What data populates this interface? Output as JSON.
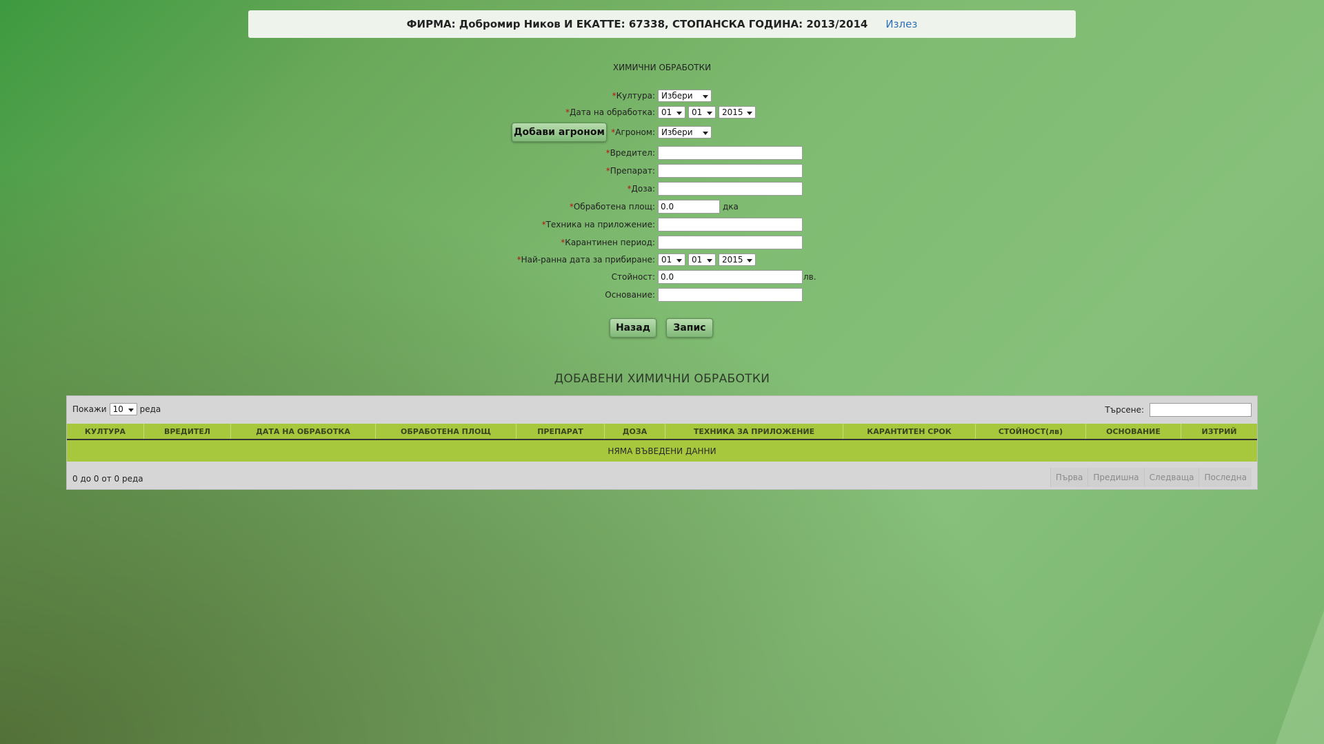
{
  "header": {
    "company_line": "ФИРМА: Добромир Ников И ЕКАТТЕ: 67338, СТОПАНСКА ГОДИНА: 2013/2014",
    "logout_label": "Излез"
  },
  "form": {
    "title": "ХИМИЧНИ ОБРАБОТКИ",
    "required_mark": "*",
    "culture": {
      "label": "Култура:",
      "value": "Избери"
    },
    "treatment_date": {
      "label": "Дата на обработка:",
      "day": "01",
      "month": "01",
      "year": "2015"
    },
    "add_agronomist_button": "Добави агроном",
    "agronomist": {
      "label": "Агроном:",
      "value": "Избери"
    },
    "pest": {
      "label": "Вредител:",
      "value": ""
    },
    "preparation": {
      "label": "Препарат:",
      "value": ""
    },
    "dose": {
      "label": "Доза:",
      "value": ""
    },
    "treated_area": {
      "label": "Обработена площ:",
      "value": "0.0",
      "unit": "дка"
    },
    "application_technique": {
      "label": "Техника на приложение:",
      "value": ""
    },
    "quarantine_period": {
      "label": "Карантинен период:",
      "value": ""
    },
    "earliest_harvest": {
      "label": "Най-ранна дата за прибиране:",
      "day": "01",
      "month": "01",
      "year": "2015"
    },
    "cost": {
      "label": "Стойност:",
      "value": "0.0",
      "unit": "лв."
    },
    "basis": {
      "label": "Основание:",
      "value": ""
    },
    "back_button": "Назад",
    "save_button": "Запис"
  },
  "table": {
    "title": "ДОБАВЕНИ ХИМИЧНИ ОБРАБОТКИ",
    "show_label": "Покажи",
    "page_size": "10",
    "rows_label": "реда",
    "search_label": "Търсене:",
    "search_value": "",
    "columns": [
      "КУЛТУРА",
      "ВРЕДИТЕЛ",
      "ДАТА НА ОБРАБОТКА",
      "ОБРАБОТЕНА ПЛОЩ",
      "ПРЕПАРАТ",
      "ДОЗА",
      "ТЕХНИКА ЗА ПРИЛОЖЕНИЕ",
      "КАРАНТИТЕН СРОК",
      "СТОЙНОСТ(лв)",
      "ОСНОВАНИЕ",
      "ИЗТРИЙ"
    ],
    "empty_message": "НЯМА ВЪВЕДЕНИ ДАННИ",
    "info": "0 до 0 от 0 реда",
    "pager": {
      "first": "Първа",
      "previous": "Предишна",
      "next": "Следваща",
      "last": "Последна"
    }
  }
}
